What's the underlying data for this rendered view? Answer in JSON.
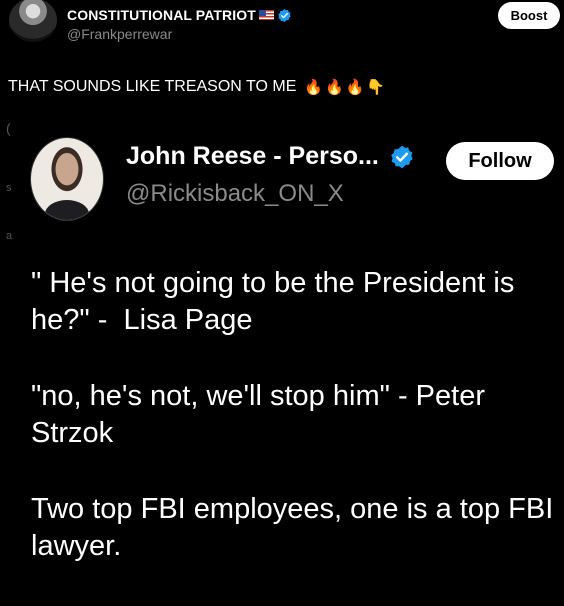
{
  "post": {
    "author_name": "CONSTITUTIONAL PATRIOT",
    "author_handle": "@Frankperrewar",
    "boost_label": "Boost",
    "text": "THAT SOUNDS LIKE TREASON TO ME",
    "emojis": [
      "🔥",
      "🔥",
      "🔥",
      "👇"
    ]
  },
  "embedded_tweet": {
    "author_name": "John Reese - Perso...",
    "author_handle": "@Rickisback_ON_X",
    "follow_label": "Follow",
    "paragraphs": [
      "\" He's not going to be the President is he?\" -  Lisa Page",
      "\"no, he's not, we'll stop him\" - Peter Strzok",
      "Two top FBI employees, one is a top FBI  lawyer."
    ]
  },
  "colors": {
    "background": "#000000",
    "secondary_text": "#8a8a8a",
    "verified_blue": "#1d9bf0"
  },
  "icons": [
    "avatar",
    "us-flag-icon",
    "verified-badge-icon",
    "fire-emoji",
    "pointing-down-emoji"
  ]
}
